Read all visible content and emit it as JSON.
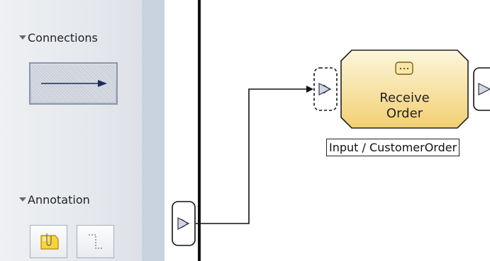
{
  "palette": {
    "connections": {
      "label": "Connections",
      "tool": {
        "icon": "connection-arrow-icon",
        "state": "selected"
      }
    },
    "annotation": {
      "label": "Annotation",
      "tools": [
        {
          "icon": "note-icon"
        },
        {
          "icon": "association-icon"
        }
      ]
    }
  },
  "canvas": {
    "task": {
      "title_line1": "Receive",
      "title_line2": "Order",
      "icon": "receive-message-icon",
      "fill_top": "#fdf6dc",
      "fill_bottom": "#f2cf72"
    },
    "input_label": "Input / CustomerOrder",
    "port_icon": "input-port-icon"
  }
}
